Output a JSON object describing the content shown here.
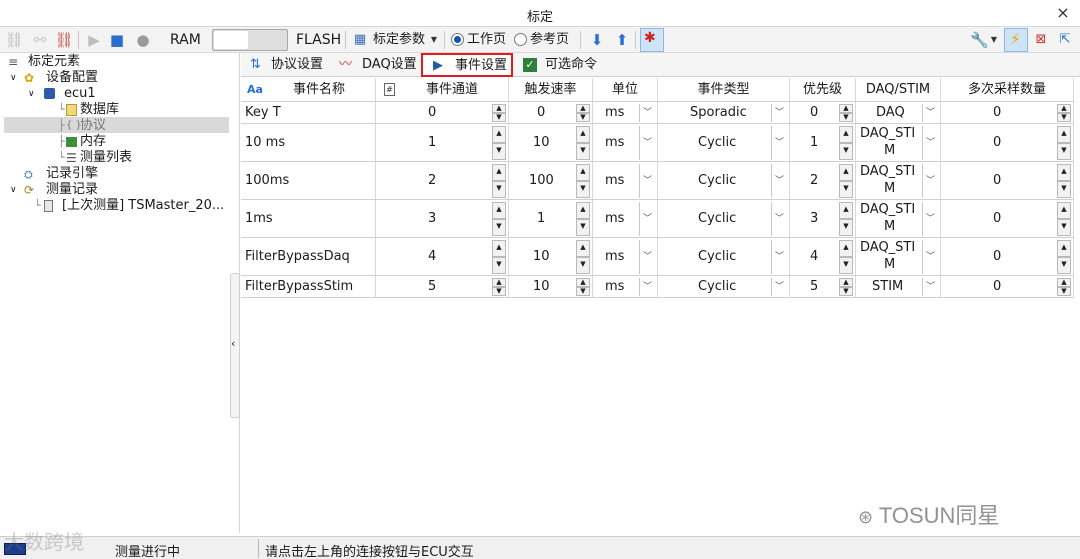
{
  "window": {
    "title": "标定",
    "close_glyph": "×"
  },
  "toolbar": {
    "ram_label": "RAM",
    "flash_label": "FLASH",
    "calib_params_label": "标定参数",
    "work_page_label": "工作页",
    "ref_page_label": "参考页",
    "selected_page": "工作页"
  },
  "tree": {
    "root": "标定元素",
    "device_config": "设备配置",
    "ecu": "ecu1",
    "database": "数据库",
    "protocol": "协议",
    "memory": "内存",
    "measurement_list": "测量列表",
    "record_engine": "记录引擎",
    "measurement_records": "测量记录",
    "last_measurement": "[上次测量] TSMaster_20..."
  },
  "tabs": [
    {
      "label": "协议设置",
      "icon": "sort-icon"
    },
    {
      "label": "DAQ设置",
      "icon": "chart-icon"
    },
    {
      "label": "事件设置",
      "icon": "play-icon"
    },
    {
      "label": "可选命令",
      "icon": "checkbox-icon"
    }
  ],
  "table": {
    "headers": [
      "事件名称",
      "事件通道",
      "触发速率",
      "单位",
      "事件类型",
      "优先级",
      "DAQ/STIM",
      "多次采样数量"
    ],
    "header_aa": "Aa",
    "header_hash": "#",
    "rows": [
      {
        "name": "Key T",
        "channel": "0",
        "rate": "0",
        "unit": "ms",
        "type": "Sporadic",
        "priority": "0",
        "daq1": "DAQ",
        "daq2": "",
        "samples": "0"
      },
      {
        "name": "10 ms",
        "channel": "1",
        "rate": "10",
        "unit": "ms",
        "type": "Cyclic",
        "priority": "1",
        "daq1": "DAQ_STI",
        "daq2": "M",
        "samples": "0"
      },
      {
        "name": "100ms",
        "channel": "2",
        "rate": "100",
        "unit": "ms",
        "type": "Cyclic",
        "priority": "2",
        "daq1": "DAQ_STI",
        "daq2": "M",
        "samples": "0"
      },
      {
        "name": "1ms",
        "channel": "3",
        "rate": "1",
        "unit": "ms",
        "type": "Cyclic",
        "priority": "3",
        "daq1": "DAQ_STI",
        "daq2": "M",
        "samples": "0"
      },
      {
        "name": "FilterBypassDaq",
        "channel": "4",
        "rate": "10",
        "unit": "ms",
        "type": "Cyclic",
        "priority": "4",
        "daq1": "DAQ_STI",
        "daq2": "M",
        "samples": "0"
      },
      {
        "name": "FilterBypassStim",
        "channel": "5",
        "rate": "10",
        "unit": "ms",
        "type": "Cyclic",
        "priority": "5",
        "daq1": "STIM",
        "daq2": "",
        "samples": "0"
      }
    ]
  },
  "status": {
    "left": "测量进行中",
    "right": "请点击左上角的连接按钮与ECU交互"
  },
  "watermarks": {
    "left": "大数跨境",
    "right": "TOSUN同星"
  },
  "colors": {
    "accent": "#0a5ab0",
    "highlight_border": "#e01c1c",
    "selected_tree_bg": "#d9d9d9"
  }
}
